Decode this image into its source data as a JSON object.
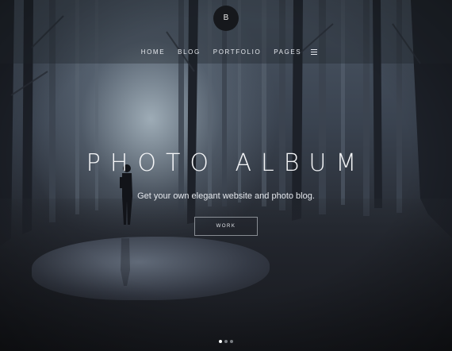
{
  "logo": {
    "letter": "B"
  },
  "nav": {
    "items": [
      {
        "label": "HOME"
      },
      {
        "label": "BLOG"
      },
      {
        "label": "PORTFOLIO"
      },
      {
        "label": "PAGES"
      }
    ],
    "menu_icon": "hamburger-icon"
  },
  "hero": {
    "title": "PHOTO ALBUM",
    "subtitle": "Get your own elegant website and photo blog.",
    "cta_label": "WORK"
  },
  "slider": {
    "total": 3,
    "active_index": 0
  },
  "colors": {
    "text": "#f4f5f7",
    "logo_bg": "#16181c",
    "dot_active": "#ffffff"
  }
}
